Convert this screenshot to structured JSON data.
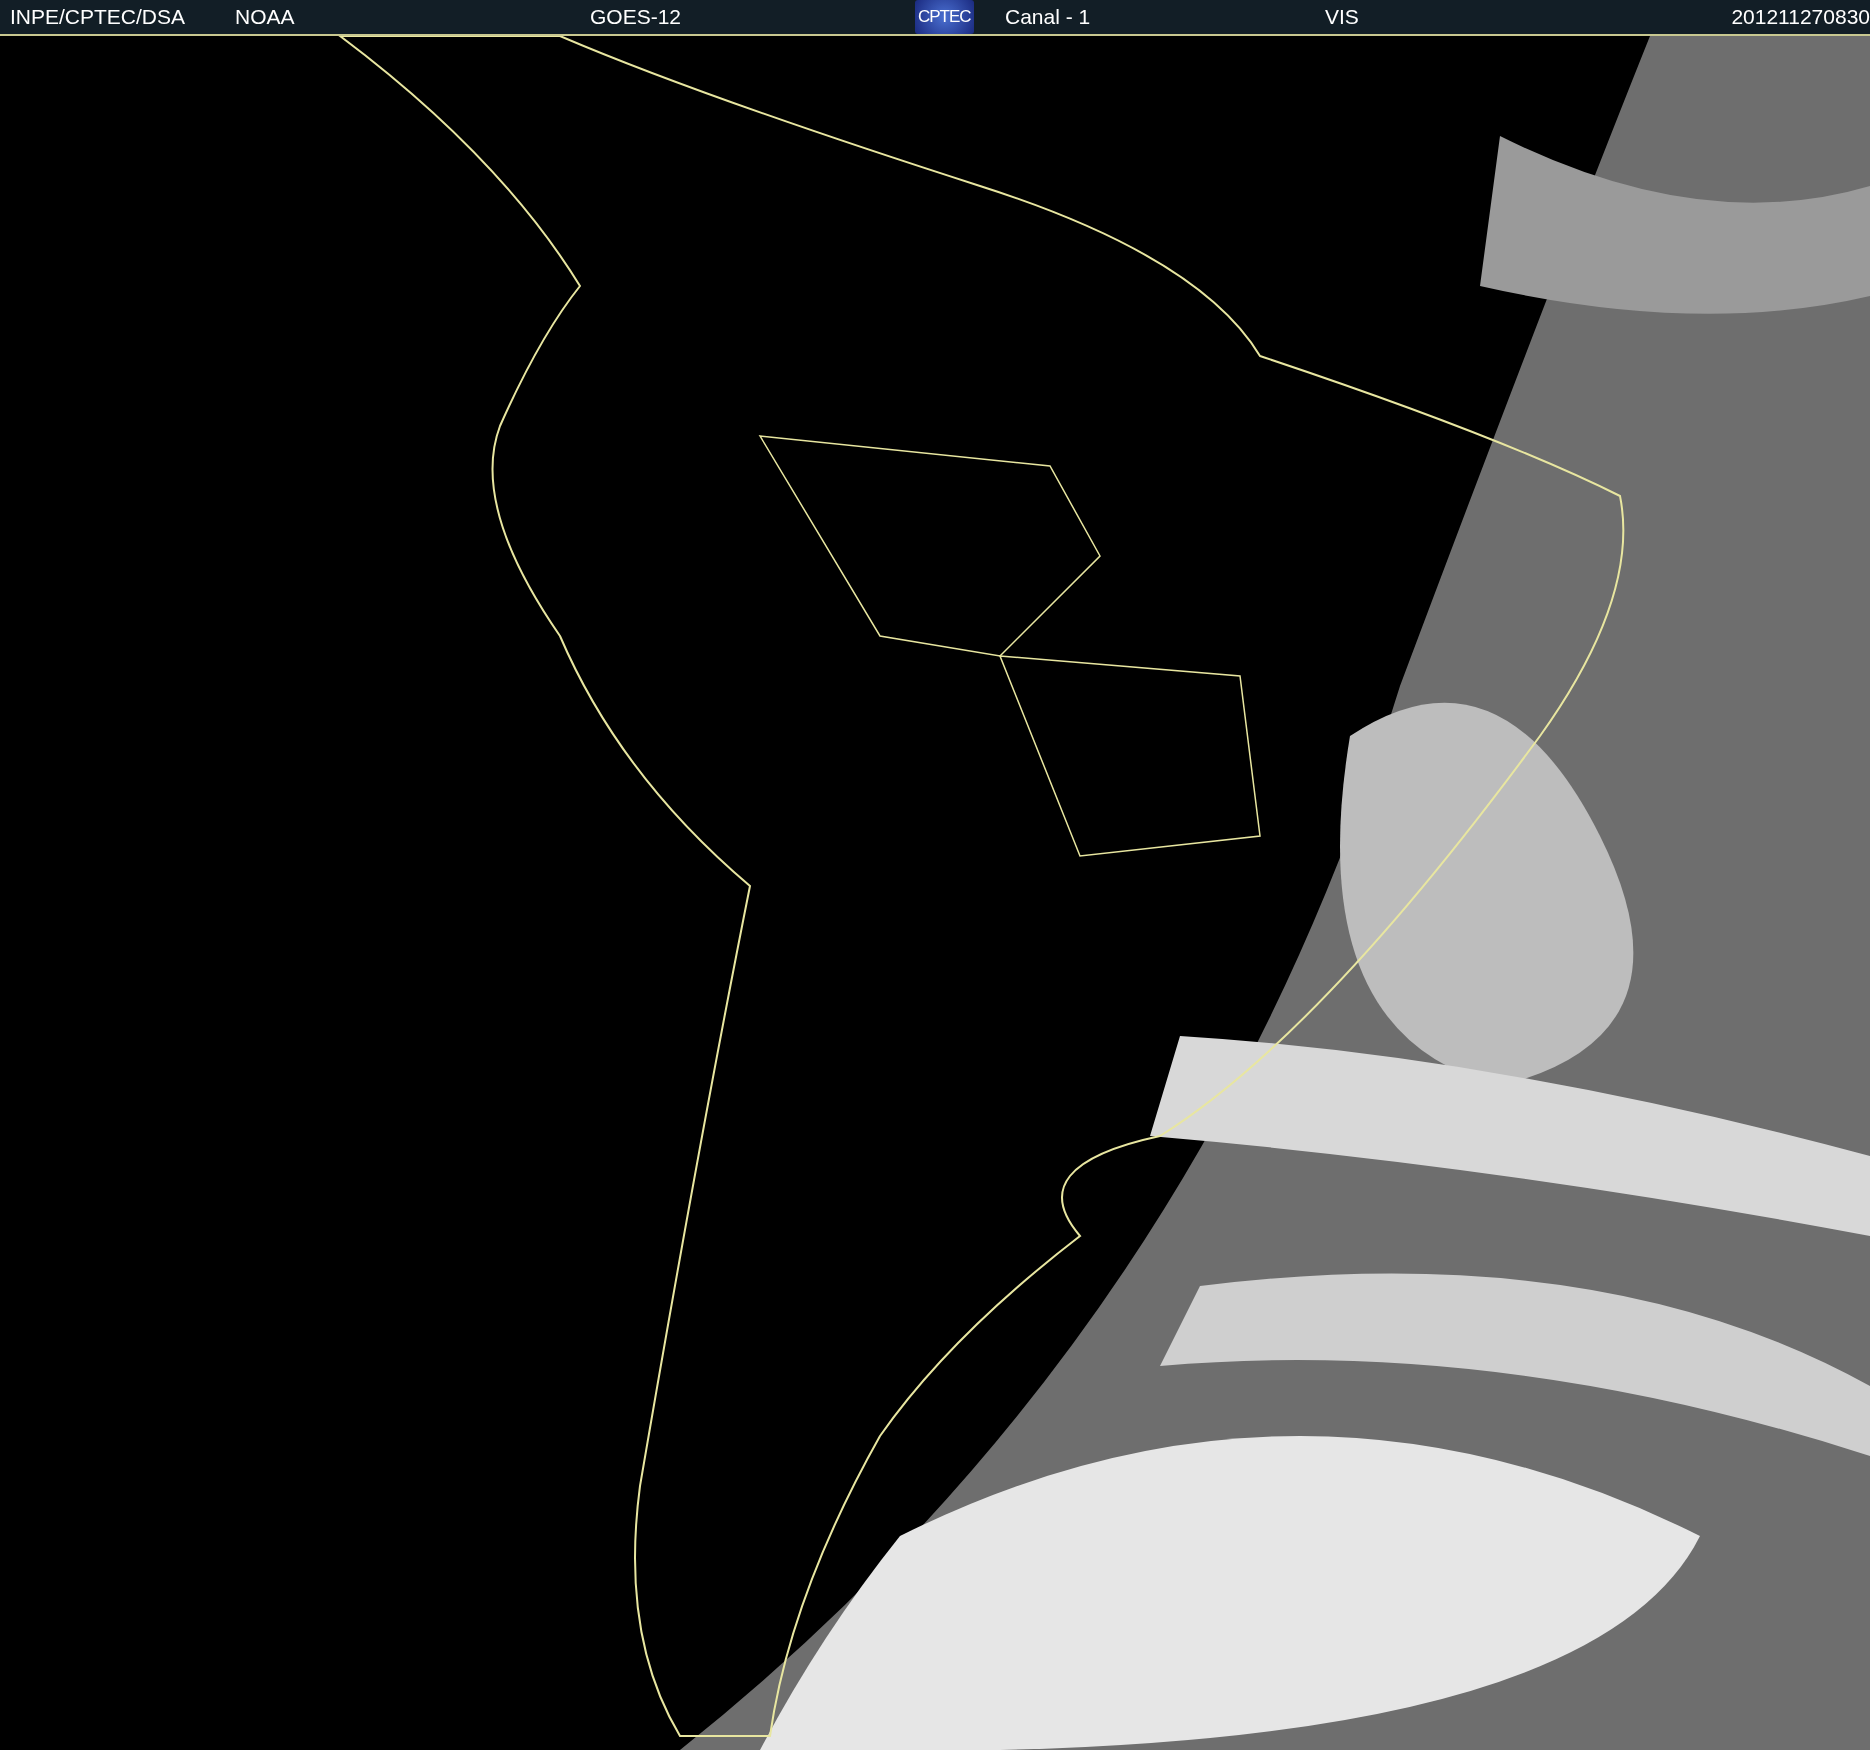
{
  "header": {
    "items": [
      {
        "kind": "text",
        "text": "INPE/CPTEC/DSA"
      },
      {
        "kind": "text",
        "text": "NOAA"
      },
      {
        "kind": "text",
        "text": "GOES-12"
      },
      {
        "kind": "logo",
        "text": "CPTEC"
      },
      {
        "kind": "text",
        "text": "Canal - 1"
      },
      {
        "kind": "text",
        "text": "VIS"
      },
      {
        "kind": "text",
        "text": "201211270830"
      }
    ]
  }
}
